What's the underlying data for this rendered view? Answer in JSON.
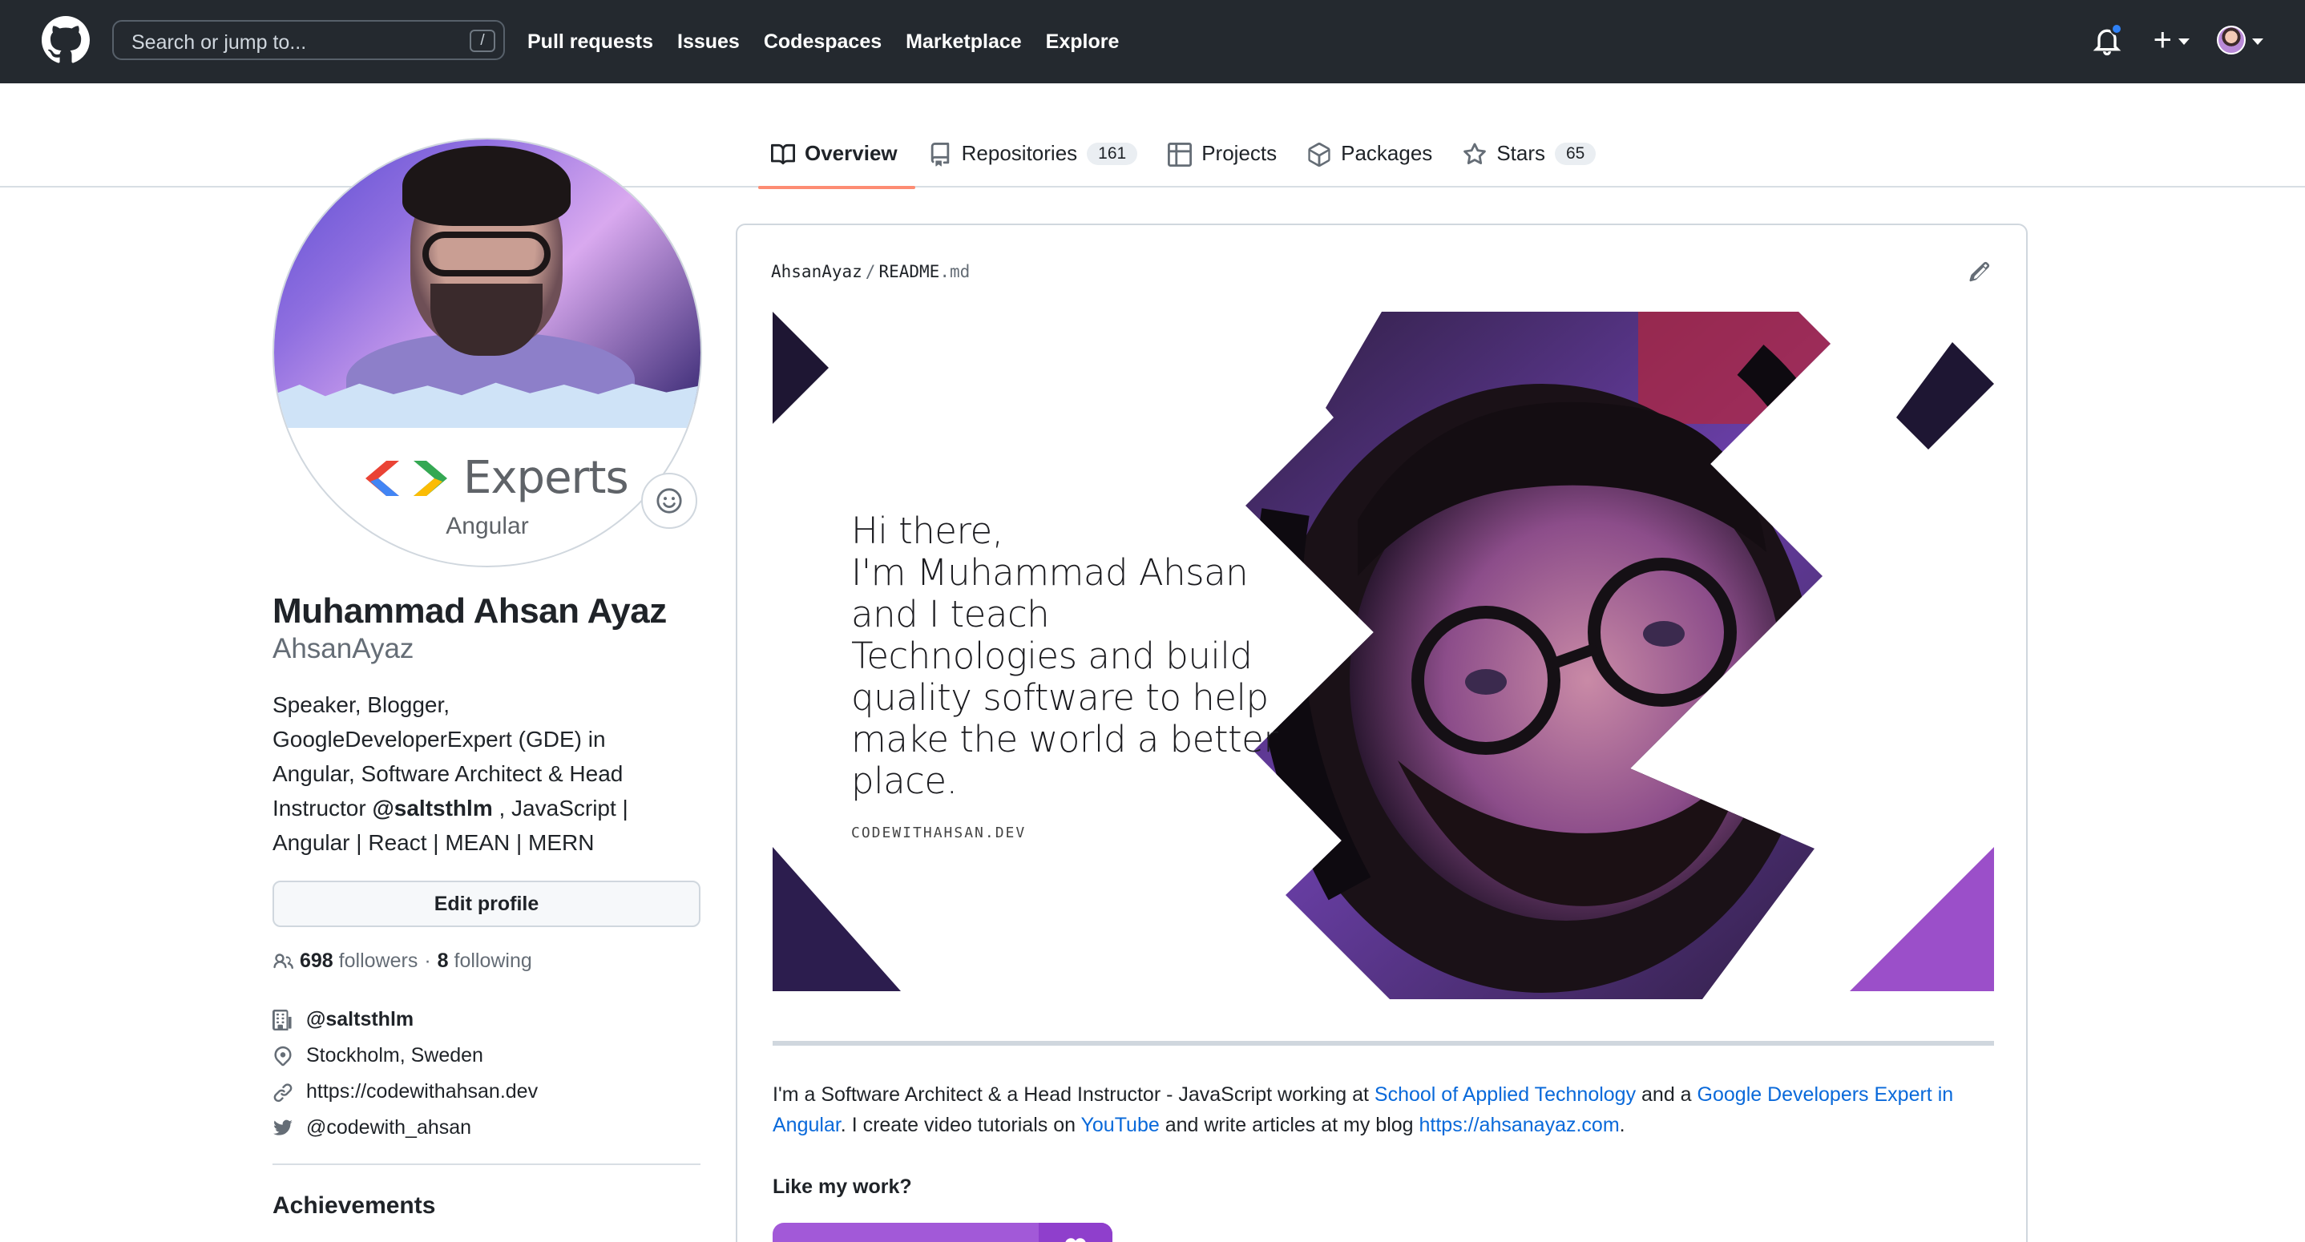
{
  "header": {
    "search_placeholder": "Search or jump to...",
    "search_shortcut": "/",
    "nav": [
      "Pull requests",
      "Issues",
      "Codespaces",
      "Marketplace",
      "Explore"
    ],
    "plus_label": "+"
  },
  "tabs": [
    {
      "label": "Overview",
      "count": null,
      "icon": "book-icon",
      "active": true
    },
    {
      "label": "Repositories",
      "count": "161",
      "icon": "repo-icon",
      "active": false
    },
    {
      "label": "Projects",
      "count": null,
      "icon": "table-icon",
      "active": false
    },
    {
      "label": "Packages",
      "count": null,
      "icon": "package-icon",
      "active": false
    },
    {
      "label": "Stars",
      "count": "65",
      "icon": "star-icon",
      "active": false
    }
  ],
  "profile": {
    "badge_word": "Experts",
    "badge_sub": "Angular",
    "full_name": "Muhammad Ahsan Ayaz",
    "username": "AhsanAyaz",
    "bio_before": "Speaker, Blogger, GoogleDeveloperExpert (GDE) in Angular, Software Architect & Head Instructor ",
    "bio_mention": "@saltsthlm",
    "bio_after": " , JavaScript | Angular | React | MEAN | MERN",
    "edit_label": "Edit profile",
    "followers_count": "698",
    "followers_label": "followers",
    "following_count": "8",
    "following_label": "following",
    "org": "@saltsthlm",
    "location": "Stockholm, Sweden",
    "website": "https://codewithahsan.dev",
    "twitter": "@codewith_ahsan",
    "achievements_title": "Achievements"
  },
  "readme": {
    "owner": "AhsanAyaz",
    "file_name": "README",
    "file_ext": ".md",
    "banner_lines": [
      "Hi there,",
      "I'm Muhammad Ahsan",
      "and I teach",
      "Technologies and build",
      "quality software to help",
      "make the world a better",
      "place."
    ],
    "banner_site": "CODEWITHAHSAN.DEV",
    "about_1": "I'm a Software Architect & a Head Instructor - JavaScript working at ",
    "about_link_1": "School of Applied Technology",
    "about_2": " and a ",
    "about_link_2": "Google Developers Expert in Angular",
    "about_3": ". I create video tutorials on ",
    "about_link_3": "YouTube",
    "about_4": " and write articles at my blog ",
    "about_link_4": "https://ahsanayaz.com",
    "about_5": ".",
    "like_title": "Like my work?"
  },
  "colors": {
    "header_bg": "#24292f",
    "link": "#0969da",
    "tab_underline": "#fd8c73",
    "banner_dark": "#1e1633",
    "banner_purple": "#9b4fc9",
    "notification_dot": "#2f81f7"
  }
}
